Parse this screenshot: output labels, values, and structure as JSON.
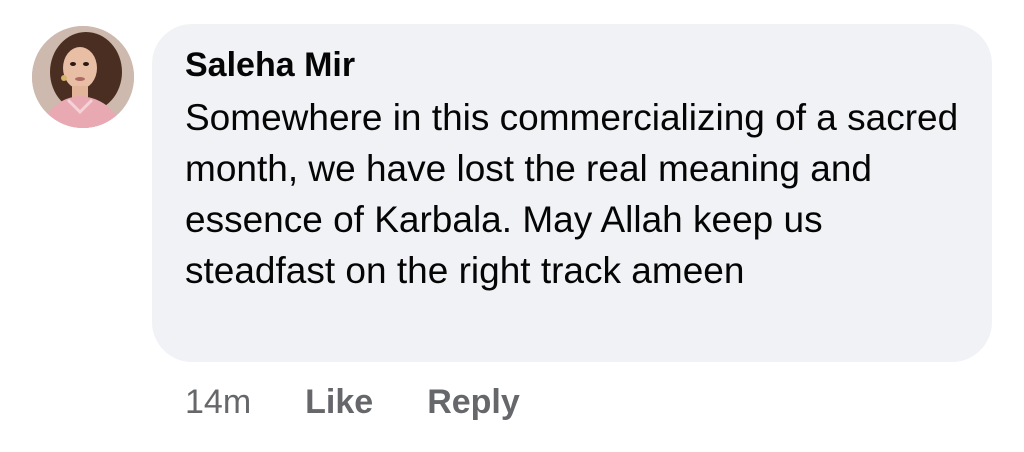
{
  "comment": {
    "author": "Saleha Mir",
    "text": "Somewhere in this commercializing of a sacred month, we have lost the real meaning and essence of Karbala. May Allah keep us steadfast on the right track ameen",
    "timestamp": "14m",
    "like_label": "Like",
    "reply_label": "Reply"
  },
  "colors": {
    "bubble_bg": "#f0f2f5",
    "text": "#050505",
    "secondary_text": "#65676b"
  }
}
